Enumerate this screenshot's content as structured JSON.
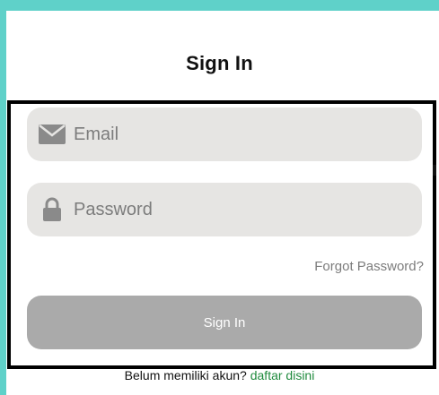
{
  "page": {
    "title": "Sign In"
  },
  "form": {
    "email_placeholder": "Email",
    "password_placeholder": "Password",
    "forgot_password_label": "Forgot Password?",
    "submit_label": "Sign In"
  },
  "footer": {
    "prompt_text": "Belum memiliki akun?",
    "register_link": "daftar disini"
  },
  "icons": {
    "email": "envelope-icon",
    "password": "lock-icon"
  },
  "colors": {
    "accent_border": "#5fd1c9",
    "field_bg": "#e6e5e3",
    "button_bg": "#aaaaaa",
    "link": "#1f8a3d"
  }
}
